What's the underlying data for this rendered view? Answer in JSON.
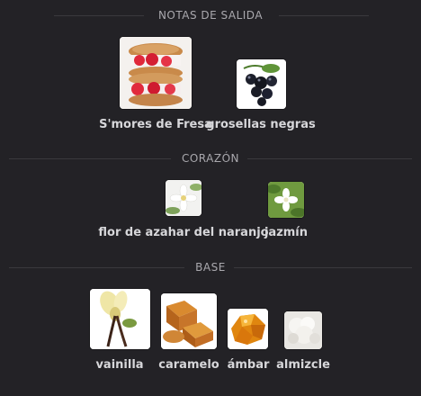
{
  "sections": [
    {
      "title": "NOTAS DE SALIDA",
      "notes": [
        {
          "label": "S'mores de Fresa",
          "icon": "strawberry-smores-image"
        },
        {
          "label": "grosellas negras",
          "icon": "blackcurrant-image"
        }
      ]
    },
    {
      "title": "CORAZÓN",
      "notes": [
        {
          "label": "flor de azahar del naranjo",
          "icon": "orange-blossom-image"
        },
        {
          "label": "jazmín",
          "icon": "jasmine-image"
        }
      ]
    },
    {
      "title": "BASE",
      "notes": [
        {
          "label": "vainilla",
          "icon": "vanilla-image"
        },
        {
          "label": "caramelo",
          "icon": "caramel-image"
        },
        {
          "label": "ámbar",
          "icon": "amber-image"
        },
        {
          "label": "almizcle",
          "icon": "musk-image"
        }
      ]
    }
  ],
  "colors": {
    "background": "#232226",
    "header_text": "#a9a8ad",
    "label_text": "#d7d7da",
    "divider": "#3a393d"
  }
}
